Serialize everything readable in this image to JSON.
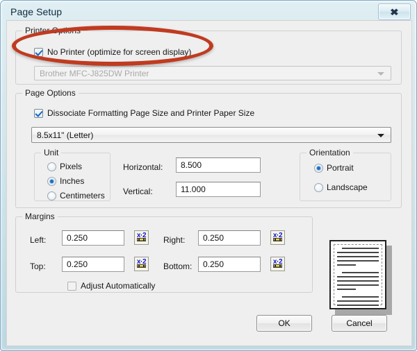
{
  "window": {
    "title": "Page Setup",
    "close_label": "✖",
    "close_icon": "close-icon"
  },
  "printer_options": {
    "legend": "Printer Options",
    "no_printer": {
      "label": "No Printer (optimize for screen display)",
      "checked": true
    },
    "printer_select": {
      "value": "Brother MFC-J825DW Printer",
      "disabled": true
    }
  },
  "page_options": {
    "legend": "Page Options",
    "dissociate": {
      "label": "Dissociate Formatting Page Size and Printer Paper Size",
      "checked": true
    },
    "page_size": {
      "value": "8.5x11\" (Letter)"
    },
    "unit": {
      "legend": "Unit",
      "options": [
        {
          "label": "Pixels",
          "selected": false
        },
        {
          "label": "Inches",
          "selected": true
        },
        {
          "label": "Centimeters",
          "selected": false
        }
      ]
    },
    "dimensions": {
      "horizontal_label": "Horizontal:",
      "horizontal_value": "8.500",
      "vertical_label": "Vertical:",
      "vertical_value": "11.000"
    },
    "orientation": {
      "legend": "Orientation",
      "options": [
        {
          "label": "Portrait",
          "selected": true
        },
        {
          "label": "Landscape",
          "selected": false
        }
      ]
    }
  },
  "margins": {
    "legend": "Margins",
    "left_label": "Left:",
    "left_value": "0.250",
    "right_label": "Right:",
    "right_value": "0.250",
    "top_label": "Top:",
    "top_value": "0.250",
    "bottom_label": "Bottom:",
    "bottom_value": "0.250",
    "doubler_icon_text": "x·2",
    "adjust_automatically": {
      "label": "Adjust Automatically",
      "checked": false
    }
  },
  "preview": {
    "name": "page-preview-thumbnail"
  },
  "buttons": {
    "ok": "OK",
    "cancel": "Cancel"
  },
  "annotation": {
    "shape": "ellipse",
    "color": "#c03b20"
  }
}
